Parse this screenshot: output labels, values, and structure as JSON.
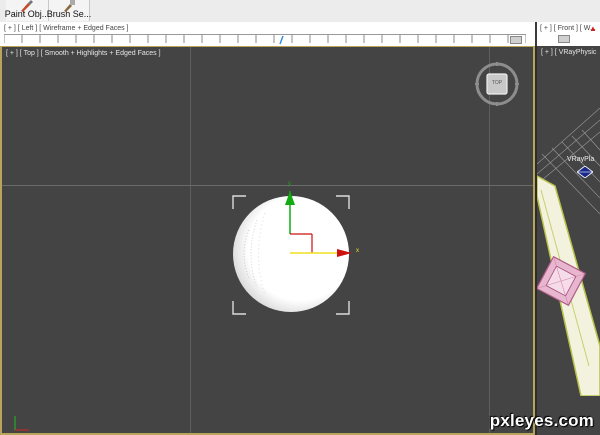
{
  "toolbar": {
    "buttons": [
      {
        "label": "Paint Obj...",
        "icon": "paint-brush-icon"
      },
      {
        "label": "Brush Se...",
        "icon": "brush-settings-icon"
      }
    ]
  },
  "strip": {
    "left_viewport_label": "[ + ] [ Left ] [ Wireframe + Edged Faces ]",
    "right_viewport_label": "[ + ] [ Front ] [ W..."
  },
  "viewports": {
    "top": {
      "label": "[ + ] [ Top ] [ Smooth + Highlights + Edged Faces ]"
    },
    "right": {
      "label": "[ + ] [ VRayPhysic",
      "object_label": "VRayPla"
    }
  },
  "viewcube": {
    "face_label": "TOP"
  },
  "gizmo": {
    "x_axis": "x",
    "y_axis": "y"
  },
  "watermark": "pxleyes.com",
  "colors": {
    "active_border": "#b9a45c",
    "viewport_bg": "#444444",
    "gizmo_x": "#cc1111",
    "gizmo_y": "#11aa11",
    "gizmo_selected": "#f0e020"
  }
}
